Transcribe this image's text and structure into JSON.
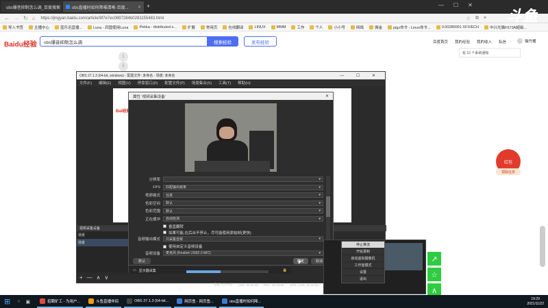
{
  "browser": {
    "tabs": [
      {
        "title": "obs爆音抑制怎么调_百度搜索",
        "active": false
      },
      {
        "title": "obs直播时如何降噪清晰-百度...",
        "active": true
      }
    ],
    "new_tab": "+",
    "win_controls": {
      "min": "—",
      "max": "☐",
      "close": "✕"
    },
    "url": "https://jingyan.baidu.com/article/9f7e7ec0897284b0281155483.html",
    "bookmarks": [
      "导入书签",
      "主播中心",
      "蓝乐迅直播...",
      "Luna - 四国使用Luna",
      "Pekka - distributed s...",
      "扩展",
      "常用页",
      "在线翻译",
      "LINUX",
      "MMM",
      "工作",
      "个人",
      "小小号",
      "网络",
      "佣金",
      "pigz命令 - Linux命令...",
      "0.00280001 XFX/ECH",
      "中兴光猫F673A超级..."
    ],
    "extra_label": "斗鱼"
  },
  "page": {
    "logo": "Baidu经验",
    "search_value": "obs爆音抑制怎么调",
    "search_button": "搜索经验",
    "publish_button": "发布经验",
    "nav": [
      "百度首页",
      "我的经验",
      "我的收入",
      "私信"
    ],
    "username": "猫丹桶",
    "notice": "有 10 个系统通知",
    "steps": [
      "1",
      "2"
    ],
    "redpacket": "红包",
    "redpacket_task": "领取任务",
    "side_icons": [
      "share-icon",
      "star-icon",
      "up-icon"
    ]
  },
  "obs": {
    "title": "OBS 27.1.3 (64-bit, windows) - 配置文件: 未命名 - 场景: 未命名",
    "menu": [
      "文件(F)",
      "编辑(E)",
      "视图(V)",
      "停靠窗口(D)",
      "配置文件(P)",
      "场景集合(S)",
      "工具(T)",
      "帮助(H)"
    ],
    "source_header": "视频采集设备",
    "scenes_header": "场景",
    "scene_item": "场景",
    "sources_header": "来源",
    "toolbar_labels": [
      "+",
      "—",
      "∧",
      "∨"
    ],
    "status": {
      "frames": "丢帧 0 (0.0%)",
      "live": "LIVE: 00:00:00",
      "rec": "REC: 00:00:00",
      "cpu": "CPU: 1.6%, 60.00 fps",
      "kbps": "kb/s: 0kB"
    },
    "footer_source": "显示器采集",
    "ctx_menu": [
      "停止推流",
      "开始录制",
      "启动虚拟摄像机",
      "工作室模式",
      "设置",
      "退出"
    ]
  },
  "dialog": {
    "title": "属性 '视频采集设备'",
    "rows": [
      {
        "label": "分辨率",
        "value": ""
      },
      {
        "label": "FPS",
        "value": "匹配输出帧率"
      },
      {
        "label": "视频格式",
        "value": "任意"
      },
      {
        "label": "色彩空间",
        "value": "默认"
      },
      {
        "label": "色彩范围",
        "value": "默认"
      },
      {
        "label": "正在缓冲",
        "value": "自动检测"
      }
    ],
    "checks": [
      "垂直翻转",
      "如果可能,在后台不停止，尽可能使用原始帧(更快)"
    ],
    "audio_row": {
      "label": "音频输出模式",
      "value": "只采集音频"
    },
    "check3": "使用自定义音频设备",
    "device_row": {
      "label": "音频设备",
      "value": "麦克风 (Realtek USB2.0 MIC)"
    },
    "defaults_button": "默认",
    "ok_button": "确定",
    "cancel_button": "取消"
  },
  "taskbar": {
    "items": [
      {
        "label": "招聘矿工 - 为用户...",
        "color": "#e24a3b"
      },
      {
        "label": "斗鱼直播伴侣",
        "color": "#f39c12"
      },
      {
        "label": "OBS 27.1.3 (64-bit...",
        "color": "#444"
      },
      {
        "label": "网页鱼 - 网页鱼...",
        "color": "#3a7bd5"
      },
      {
        "label": "obs直播时如何降...",
        "color": "#3a7bd5"
      }
    ],
    "time": "19:29",
    "date": "2021/11/22"
  }
}
